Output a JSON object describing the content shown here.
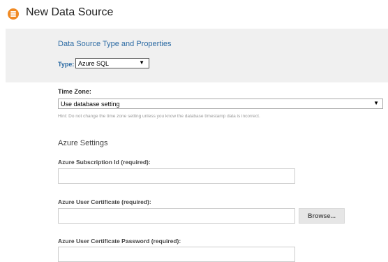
{
  "header": {
    "title": "New Data Source",
    "icon": "database-icon",
    "icon_color": "#f08a24"
  },
  "type_section": {
    "title": "Data Source Type and Properties",
    "type_label": "Type:",
    "type_value": "Azure SQL",
    "accent_color": "#2b6aa3"
  },
  "timezone": {
    "label": "Time Zone:",
    "value": "Use database setting",
    "hint": "Hint: Do not change the time zone setting unless you know the database timestamp data is incorrect."
  },
  "azure": {
    "heading": "Azure Settings",
    "subscription_label": "Azure Subscription Id (required):",
    "subscription_value": "",
    "certificate_label": "Azure User Certificate (required):",
    "certificate_value": "",
    "browse_label": "Browse...",
    "password_label": "Azure User Certificate Password (required):",
    "password_value": ""
  }
}
